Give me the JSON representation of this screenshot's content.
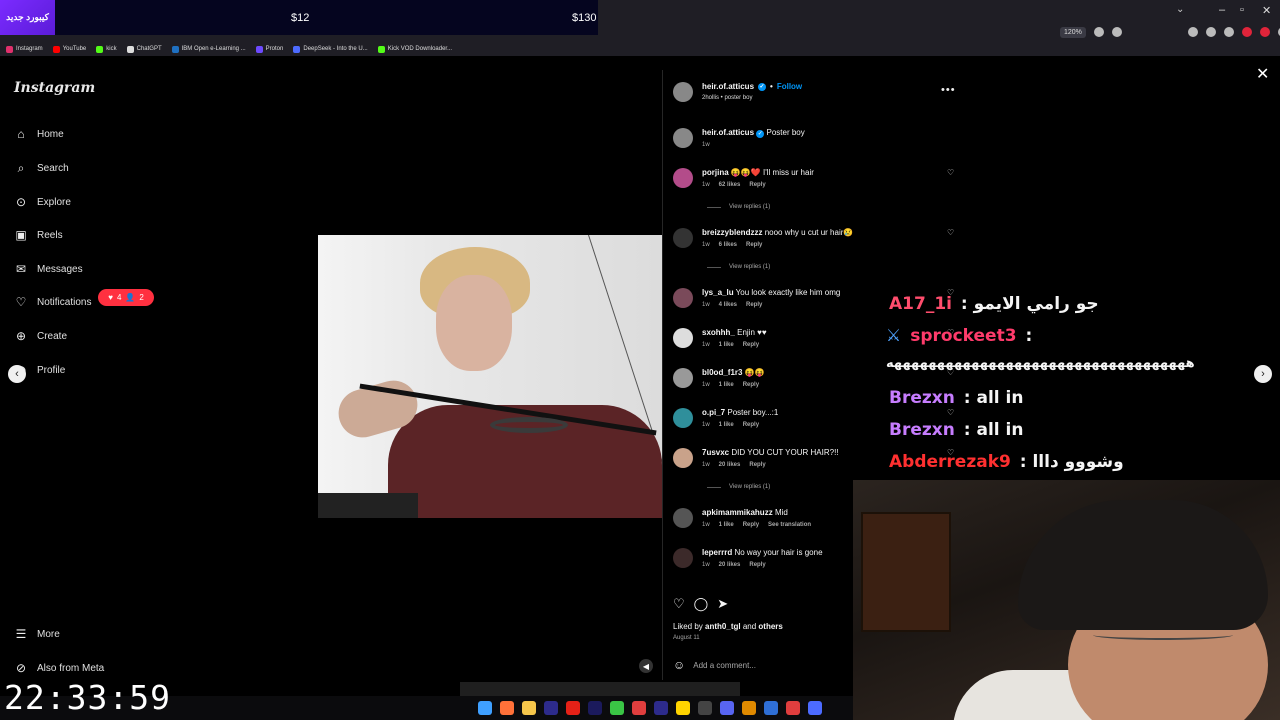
{
  "promo": {
    "badge": "كيبورد جديد",
    "price_1": "$12",
    "price_2": "$130"
  },
  "browser": {
    "zoom": "120%",
    "bookmarks": [
      {
        "label": "Instagram",
        "color": "#e1306c"
      },
      {
        "label": "YouTube",
        "color": "#ff0000"
      },
      {
        "label": "kick",
        "color": "#53fc18"
      },
      {
        "label": "ChatGPT",
        "color": "#dddddd"
      },
      {
        "label": "IBM Open e-Learning ...",
        "color": "#1f70c1"
      },
      {
        "label": "Proton",
        "color": "#6d4aff"
      },
      {
        "label": "DeepSeek - Into the U...",
        "color": "#4d6bfe"
      },
      {
        "label": "Kick VOD Downloader...",
        "color": "#53fc18"
      }
    ]
  },
  "sidebar": {
    "logo": "Instagram",
    "items": [
      {
        "label": "Home",
        "icon": "home-icon"
      },
      {
        "label": "Search",
        "icon": "search-icon"
      },
      {
        "label": "Explore",
        "icon": "compass-icon"
      },
      {
        "label": "Reels",
        "icon": "reels-icon"
      },
      {
        "label": "Messages",
        "icon": "messages-icon"
      },
      {
        "label": "Notifications",
        "icon": "heart-icon"
      },
      {
        "label": "Create",
        "icon": "plus-icon"
      },
      {
        "label": "Profile",
        "icon": "profile-icon"
      }
    ],
    "notif_likes": "4",
    "notif_follows": "2",
    "more": "More",
    "also_from_meta": "Also from Meta"
  },
  "post": {
    "username": "heir.of.atticus",
    "follow": "Follow",
    "subtitle": "2hollis • poster boy",
    "caption_user": "heir.of.atticus",
    "caption_text": "Poster boy",
    "caption_time": "1w",
    "comments": [
      {
        "user": "porjina",
        "text": "😝😝❤️ I'll miss ur hair",
        "time": "1w",
        "likes": "62 likes",
        "reply": "Reply",
        "view_replies": "View replies (1)"
      },
      {
        "user": "breizzyblendzzz",
        "text": "nooo why u cut ur hair😢",
        "time": "1w",
        "likes": "6 likes",
        "reply": "Reply",
        "view_replies": "View replies (1)"
      },
      {
        "user": "lys_a_lu",
        "text": "You look exactly like him omg",
        "time": "1w",
        "likes": "4 likes",
        "reply": "Reply"
      },
      {
        "user": "sxohhh_",
        "text": "Enjin ♥♥",
        "time": "1w",
        "likes": "1 like",
        "reply": "Reply"
      },
      {
        "user": "bl0od_f1r3",
        "text": "😝😝",
        "time": "1w",
        "likes": "1 like",
        "reply": "Reply"
      },
      {
        "user": "o.pi_7",
        "text": "Poster boy...:1",
        "time": "1w",
        "likes": "1 like",
        "reply": "Reply"
      },
      {
        "user": "7usvxc",
        "text": "DID YOU CUT YOUR HAIR?!!",
        "time": "1w",
        "likes": "20 likes",
        "reply": "Reply",
        "view_replies": "View replies (1)"
      },
      {
        "user": "apkimammikahuzz",
        "text": "Mid",
        "time": "1w",
        "likes": "1 like",
        "reply": "Reply",
        "translation": "See translation"
      },
      {
        "user": "leperrrd",
        "text": "No way your hair is gone",
        "time": "1w",
        "likes": "20 likes",
        "reply": "Reply"
      }
    ],
    "liked_by_prefix": "Liked by ",
    "liked_by_user": "anth0_tgl",
    "liked_by_and": " and ",
    "liked_by_others": "others",
    "date": "August 11",
    "add_comment": "Add a comment..."
  },
  "chat": [
    {
      "user": "A17_1i",
      "sep": " : ",
      "text": "جو رامي الايمو",
      "color": "#ff4d6d"
    },
    {
      "user": "sprockeet3",
      "sep": " :",
      "text": "",
      "color": "#ff3b6b",
      "icon": "sword-icon"
    },
    {
      "user": "",
      "sep": "",
      "text": "هههههههههههههههههههههههههههههههههههه",
      "color": "#ffffff"
    },
    {
      "user": "Brezxn",
      "sep": " : ",
      "text": "all in",
      "color": "#c77dff"
    },
    {
      "user": "Brezxn",
      "sep": " : ",
      "text": "all in",
      "color": "#c77dff"
    },
    {
      "user": "Abderrezak9",
      "sep": " : ",
      "text": "وشووو دااا",
      "color": "#ff3030"
    }
  ],
  "clock": "22:33:59",
  "colors": {
    "accent": "#0095f6",
    "notif": "#ff3040",
    "bg": "#000000"
  }
}
